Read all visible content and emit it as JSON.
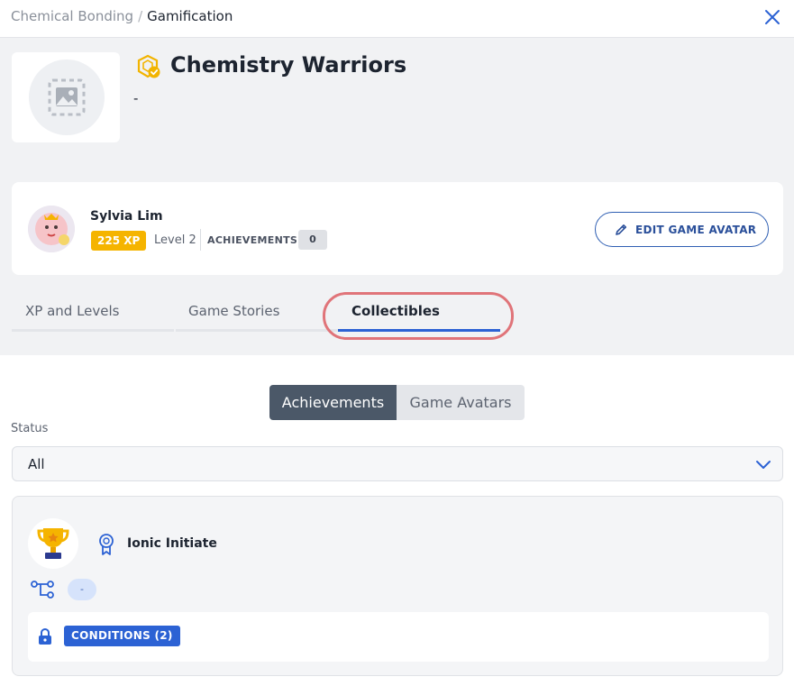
{
  "breadcrumb": {
    "parent": "Chemical Bonding",
    "separator": "/",
    "current": "Gamification"
  },
  "game": {
    "title": "Chemistry Warriors",
    "description": "-"
  },
  "player": {
    "name": "Sylvia Lim",
    "xp": "225 XP",
    "level": "Level 2",
    "achievements_label": "ACHIEVEMENTS",
    "achievements_count": "0",
    "edit_avatar_label": "EDIT GAME AVATAR"
  },
  "tabs": [
    {
      "label": "XP and Levels",
      "active": false
    },
    {
      "label": "Game Stories",
      "active": false
    },
    {
      "label": "Collectibles",
      "active": true
    }
  ],
  "segmented": {
    "options": [
      "Achievements",
      "Game Avatars"
    ],
    "selected": "Achievements"
  },
  "filter": {
    "label": "Status",
    "value": "All"
  },
  "achievements": [
    {
      "name": "Ionic Initiate",
      "path_value": "-",
      "conditions_label": "CONDITIONS (2)"
    }
  ],
  "colors": {
    "accent": "#2c62d4",
    "xp_badge": "#f5b400",
    "highlight_ring": "#e07479",
    "segment_active": "#4b5868"
  },
  "icons": {
    "close": "close-icon",
    "image_placeholder": "image-placeholder-icon",
    "game_badge": "game-badge-icon",
    "edit": "pencil-icon",
    "dropdown": "chevron-down-icon",
    "trophy": "trophy-icon",
    "ribbon": "ribbon-icon",
    "path": "path-icon",
    "lock": "lock-icon"
  }
}
